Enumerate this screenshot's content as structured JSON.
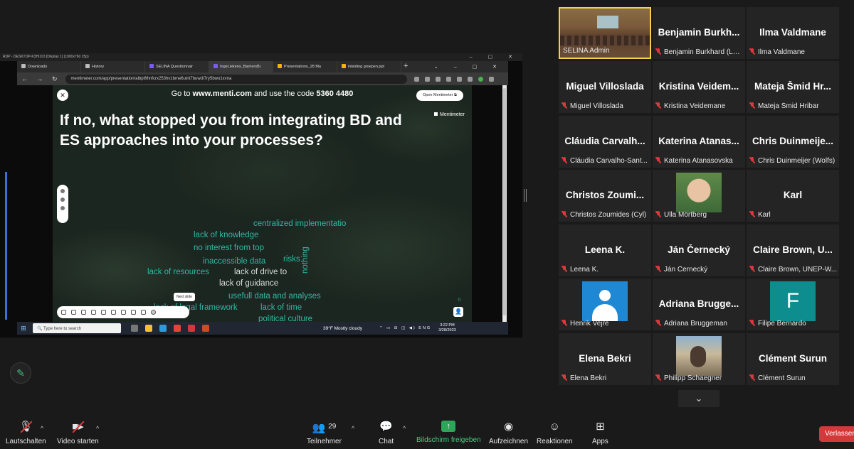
{
  "shared_screen": {
    "remote_title": "RDP - DESKTOP-K3HI1IO [Display 1] (1900x760 25p)",
    "tabs": [
      {
        "label": "Downloads"
      },
      {
        "label": "History"
      },
      {
        "label": "SELINA Questionnair"
      },
      {
        "label": "IngeLiekens_BarriersBi"
      },
      {
        "label": "Presentations_28 Ma"
      },
      {
        "label": "inleiding groepen.ppt"
      }
    ],
    "url": "mentimeter.com/app/presentation/albptfthnfcrx253hv1bme6uint7buwd/7ry5bwo1xvna",
    "slide": {
      "code_prefix": "Go to",
      "site": "www.menti.com",
      "code_middle": "and use the code",
      "code": "5360 4480",
      "open_button": "Open Mentimeter",
      "logo": "Mentimeter",
      "question": "If no, what stopped you from integrating BD and ES approaches into your processes?",
      "words": [
        "centralized implementatio",
        "lack of knowledge",
        "no interest from top",
        "inaccessible data",
        "risks",
        "lack of resources",
        "lack of drive to",
        "lack of guidance",
        "nothing",
        "usefull data and analyses",
        "lack of legal framework",
        "lack of time",
        "political culture"
      ],
      "tooltip": "Next slide",
      "counter": "0"
    },
    "taskbar": {
      "search_placeholder": "Type here to search",
      "weather": "39°F  Mostly cloudy",
      "lang": "ENG",
      "time": "3:22 PM",
      "date": "3/28/2023"
    }
  },
  "participants": [
    {
      "big": "",
      "label": "SELINA Admin",
      "muted": false,
      "video": "room"
    },
    {
      "big": "Benjamin Burkh...",
      "label": "Benjamin Burkhard (LU...",
      "muted": true
    },
    {
      "big": "Ilma Valdmane",
      "label": "Ilma Valdmane",
      "muted": true
    },
    {
      "big": "Miguel Villoslada",
      "label": "Miguel Villoslada",
      "muted": true
    },
    {
      "big": "Kristina Veidem...",
      "label": "Kristina Veidemane",
      "muted": true
    },
    {
      "big": "Mateja Šmid Hr...",
      "label": "Mateja Šmid Hribar",
      "muted": true
    },
    {
      "big": "Cláudia Carvalh...",
      "label": "Cláudia Carvalho-Sant...",
      "muted": true
    },
    {
      "big": "Katerina Atanas...",
      "label": "Katerina Atanasovska",
      "muted": true
    },
    {
      "big": "Chris Duinmeije...",
      "label": "Chris Duinmeijer (Wolfs)",
      "muted": true
    },
    {
      "big": "Christos Zoumi...",
      "label": "Christos Zoumides (Cyl)",
      "muted": true
    },
    {
      "big": "",
      "label": "Ulla Mörtberg",
      "muted": true,
      "video": "ulla"
    },
    {
      "big": "Karl",
      "label": "Karl",
      "muted": true
    },
    {
      "big": "Leena K.",
      "label": "Leena K.",
      "muted": true
    },
    {
      "big": "Ján Černecký",
      "label": "Ján Černecký",
      "muted": true
    },
    {
      "big": "Claire Brown, U...",
      "label": "Claire Brown, UNEP-W...",
      "muted": true
    },
    {
      "big": "",
      "label": "Henrik Vejre",
      "muted": true,
      "video": "henrik"
    },
    {
      "big": "Adriana Brugge...",
      "label": "Adriana Bruggeman",
      "muted": true
    },
    {
      "big": "",
      "label": "Filipe Bernardo",
      "muted": true,
      "video": "filipe",
      "initial": "F"
    },
    {
      "big": "Elena Bekri",
      "label": "Elena Bekri",
      "muted": true
    },
    {
      "big": "",
      "label": "Philipp Schaegner",
      "muted": true,
      "video": "philipp"
    },
    {
      "big": "Clément Surun",
      "label": "Clément Surun",
      "muted": true
    }
  ],
  "toolbar": {
    "mute": "Lautschalten",
    "video": "Video starten",
    "participants": "Teilnehmer",
    "participant_count": "29",
    "chat": "Chat",
    "share": "Bildschirm freigeben",
    "record": "Aufzeichnen",
    "reactions": "Reaktionen",
    "apps": "Apps",
    "leave": "Verlassen"
  },
  "colors": {
    "accent_green": "#2ea65a",
    "word_teal": "#2eb8a4",
    "mute_red": "#e0383e",
    "active_speaker": "#f1d34a"
  }
}
